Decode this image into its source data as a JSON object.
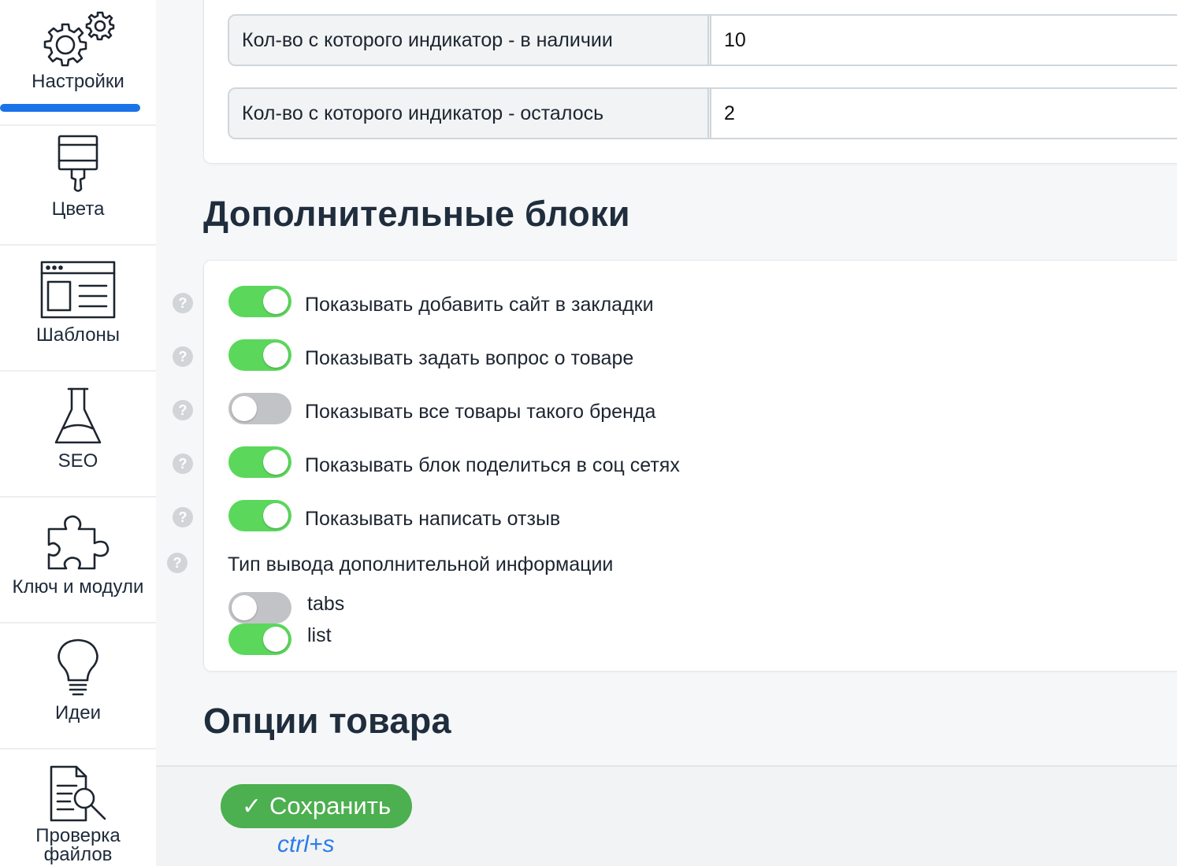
{
  "sidebar": {
    "items": [
      {
        "label": "Настройки",
        "icon": "gears-icon",
        "active": true
      },
      {
        "label": "Цвета",
        "icon": "paint-brush-icon"
      },
      {
        "label": "Шаблоны",
        "icon": "browser-template-icon"
      },
      {
        "label": "SEO",
        "icon": "flask-icon"
      },
      {
        "label": "Ключ и модули",
        "icon": "puzzle-icon"
      },
      {
        "label": "Идеи",
        "icon": "lightbulb-icon"
      },
      {
        "label": "Проверка файлов",
        "icon": "document-search-icon"
      }
    ],
    "accent_color": "#1a73e8"
  },
  "stock_settings": {
    "rows": [
      {
        "label": "Кол-во с которого индикатор - в наличии",
        "value": "10"
      },
      {
        "label": "Кол-во с которого индикатор - осталось",
        "value": "2"
      }
    ]
  },
  "additional_blocks": {
    "title": "Дополнительные блоки",
    "help_glyph": "?",
    "toggles": [
      {
        "label": "Показывать добавить сайт в закладки",
        "on": true
      },
      {
        "label": "Показывать задать вопрос о товаре",
        "on": true
      },
      {
        "label": "Показывать все товары такого бренда",
        "on": false
      },
      {
        "label": "Показывать блок поделиться в соц сетях",
        "on": true
      },
      {
        "label": "Показывать написать отзыв",
        "on": true
      }
    ],
    "output_type": {
      "label": "Тип вывода дополнительной информации",
      "options": [
        {
          "label": "tabs",
          "on": false
        },
        {
          "label": "list",
          "on": true
        }
      ]
    },
    "toggle_on_color": "#5bd75c",
    "toggle_off_color": "#c1c3c6"
  },
  "product_options": {
    "title": "Опции товара"
  },
  "footer": {
    "save_label": "Сохранить",
    "save_check": "✓",
    "shortcut": "ctrl+s",
    "save_color": "#4caf50"
  }
}
